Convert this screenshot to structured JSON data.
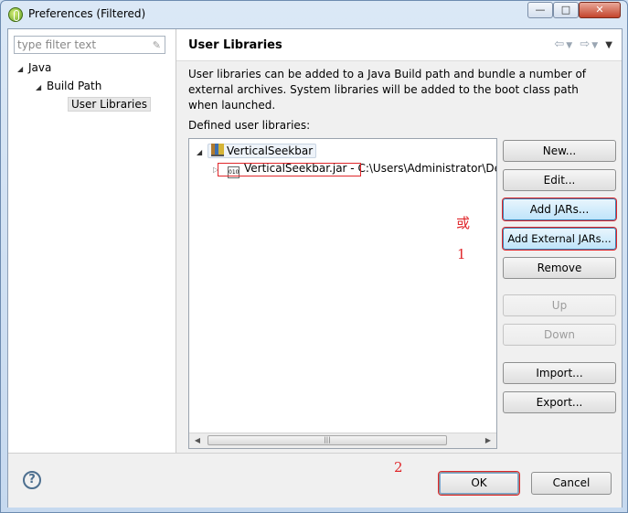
{
  "window": {
    "title": "Preferences (Filtered)",
    "min_glyph": "—",
    "max_glyph": "□",
    "close_glyph": "✕"
  },
  "filter": {
    "placeholder": "type filter text"
  },
  "nav_tree": {
    "items": [
      {
        "label": "Java",
        "depth": 0,
        "expanded": true
      },
      {
        "label": "Build Path",
        "depth": 1,
        "expanded": true
      },
      {
        "label": "User Libraries",
        "depth": 2,
        "selected": true
      }
    ]
  },
  "page": {
    "title": "User Libraries",
    "description": "User libraries can be added to a Java Build path and bundle a number of external archives. System libraries will be added to the boot class path when launched.",
    "defined_label": "Defined user libraries:"
  },
  "libraries": {
    "library_name": "VerticalSeekbar",
    "jar_entry": "VerticalSeekbar.jar - C:\\Users\\Administrator\\De"
  },
  "buttons": {
    "new": "New...",
    "edit": "Edit...",
    "add_jars": "Add JARs...",
    "add_external_jars": "Add External JARs...",
    "remove": "Remove",
    "up": "Up",
    "down": "Down",
    "import": "Import...",
    "export": "Export..."
  },
  "annotations": {
    "or_mark": "或",
    "step1": "1",
    "step2": "2"
  },
  "dialog": {
    "ok": "OK",
    "cancel": "Cancel",
    "help": "?"
  },
  "colors": {
    "annotation_red": "#e0262a",
    "hot_button": "#bfe4fa"
  }
}
